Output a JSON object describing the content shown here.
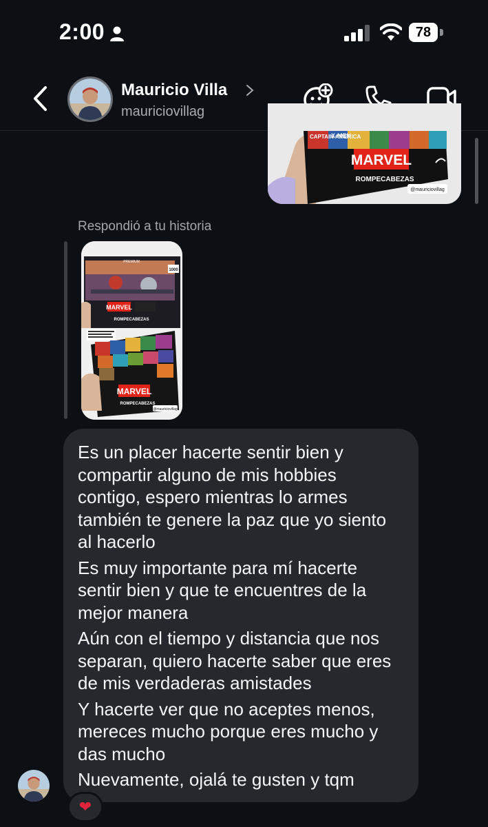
{
  "status_bar": {
    "time": "2:00",
    "battery": "78"
  },
  "header": {
    "name": "Mauricio Villa",
    "username": "mauriciovillag"
  },
  "sent_story": {
    "brand": "MARVEL",
    "product": "ROMPECABEZAS",
    "handle": "@mauriciovillag",
    "comic_top_left": "X-MEN",
    "comic_bottom_left": "CAPTAIN AMERICA"
  },
  "reply": {
    "note": "Respondió a tu historia",
    "story": {
      "banner": "PREMIUM",
      "count": "1000",
      "brand": "MARVEL",
      "product": "ROMPECABEZAS",
      "brand2": "MARVEL",
      "product2": "ROMPECABEZAS",
      "handle": "@mauriciovillag"
    }
  },
  "message": {
    "lines": [
      "Es un placer hacerte sentir bien y",
      "compartir alguno de mis hobbies",
      "contigo, espero mientras lo armes",
      "también te genere la paz que yo siento",
      "al hacerlo",
      "Es muy importante para mí hacerte",
      "sentir bien y que te encuentres de la",
      "mejor manera",
      "Aún con el tiempo y distancia que nos",
      "separan, quiero hacerte saber que eres",
      "de mis verdaderas amistades",
      "Y hacerte ver que no aceptes menos,",
      "mereces mucho porque eres mucho y",
      "das mucho",
      "Nuevamente, ojalá te gusten y tqm"
    ]
  },
  "reaction": {
    "icon": "heart-icon",
    "glyph": "❤",
    "color": "#e0243c"
  },
  "colors": {
    "background": "#0c0f14",
    "bubble": "#25282d",
    "muted_text": "#a3a7ad"
  }
}
